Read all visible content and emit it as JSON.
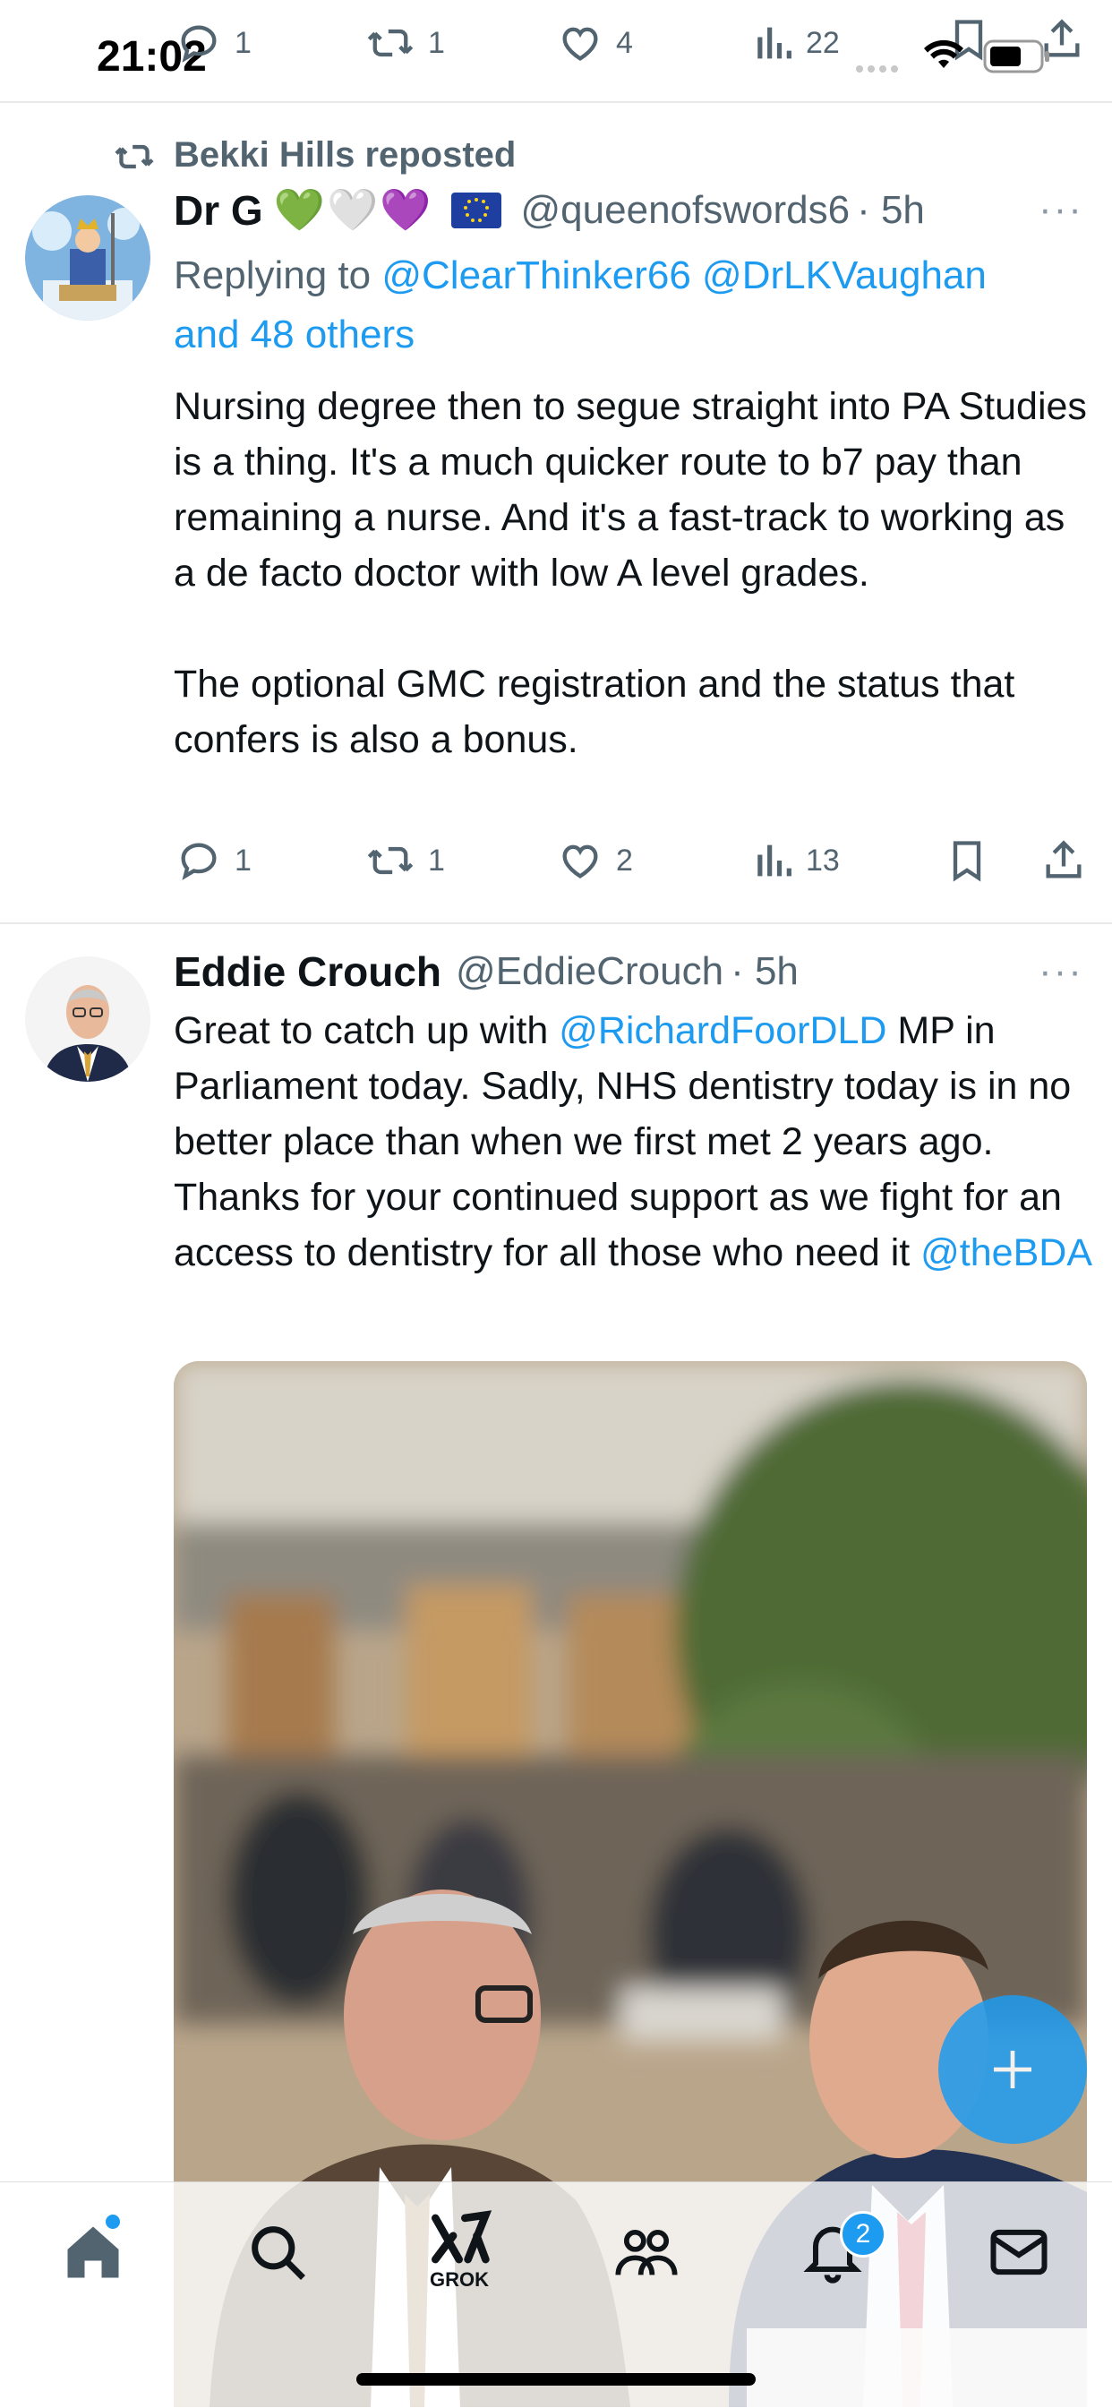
{
  "status_bar": {
    "time": "21:02"
  },
  "top_stats": {
    "replies": "1",
    "reposts": "1",
    "likes": "4",
    "views": "22"
  },
  "tweet1": {
    "reposted_by": "Bekki Hills reposted",
    "name": "Dr G",
    "emoji": "💚🤍💜",
    "handle": "@queenofswords6",
    "time": "· 5h",
    "reply_prefix": "Replying to ",
    "reply_mentions": "@ClearThinker66 @DrLKVaughan",
    "reply_others": "and 48 others",
    "text": "Nursing degree then to segue straight into PA Studies is a thing. It's a much quicker route to b7 pay than remaining a nurse. And it's a fast-track to working as a de facto doctor with low A level grades.\n\nThe optional GMC registration and the status that confers is also a bonus.",
    "replies": "1",
    "reposts": "1",
    "likes": "2",
    "views": "13"
  },
  "tweet2": {
    "name": "Eddie Crouch",
    "handle": "@EddieCrouch",
    "time": "· 5h",
    "text_1": "Great to catch up with ",
    "mention_1": "@RichardFoorDLD",
    "text_2": " MP in Parliament today. Sadly, NHS dentistry today is in no better place than when we first met 2 years ago. Thanks for your continued support as we fight for an access to dentistry for all those who need it ",
    "mention_2": "@theBDA"
  },
  "more_label": "···",
  "nav": {
    "grok_label": "GROK",
    "notifications_badge": "2",
    "items": [
      "home-icon",
      "search-icon",
      "grok-icon",
      "communities-icon",
      "notifications-icon",
      "messages-icon"
    ]
  },
  "colors": {
    "accent": "#1d9bf0",
    "text": "#0f1419",
    "muted": "#536471"
  }
}
